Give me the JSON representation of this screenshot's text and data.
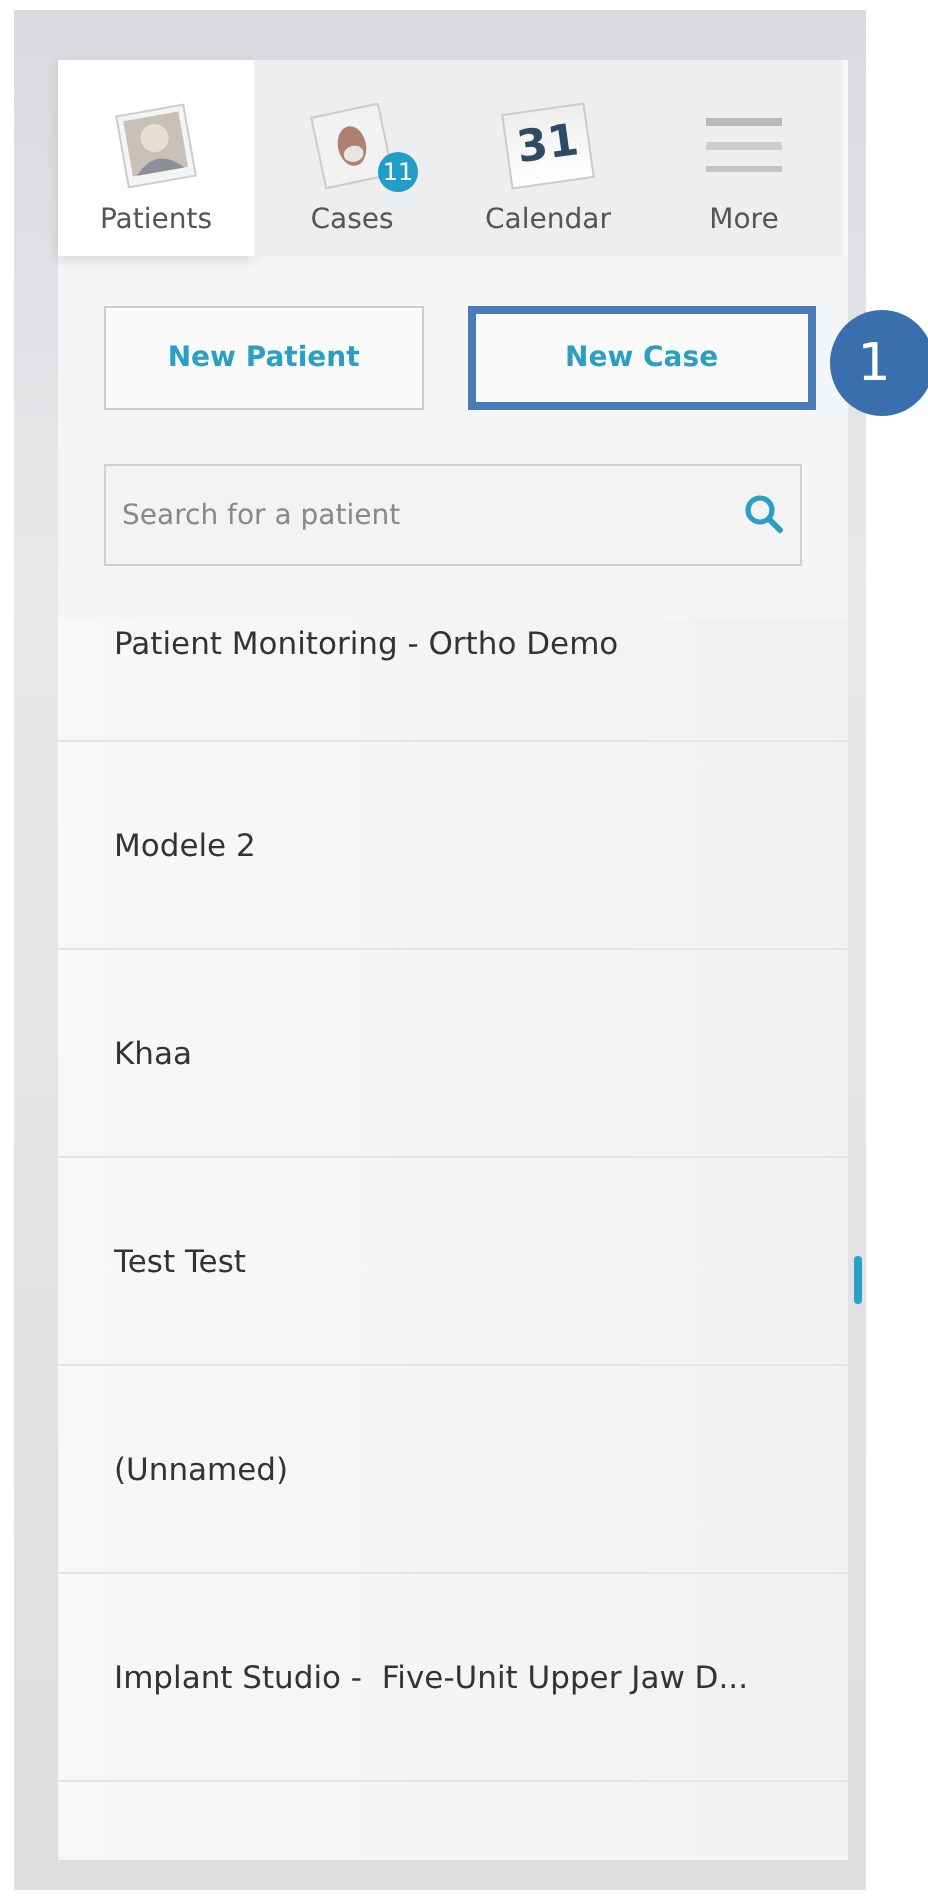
{
  "tabs": [
    {
      "kind": "photo",
      "label": "Patients",
      "selected": true
    },
    {
      "kind": "cases",
      "label": "Cases",
      "selected": false,
      "badge": "11"
    },
    {
      "kind": "calendar",
      "label": "Calendar",
      "selected": false,
      "icon_text": "31"
    },
    {
      "kind": "menu",
      "label": "More",
      "selected": false
    }
  ],
  "buttons": [
    {
      "label": "New Patient",
      "highlighted": false
    },
    {
      "label": "New Case",
      "highlighted": true
    }
  ],
  "callout": "1",
  "search": {
    "placeholder": "Search for a patient"
  },
  "patients": [
    "Patient Monitoring - Ortho Demo",
    "Modele 2",
    "Khaa",
    "Test Test",
    "(Unnamed)",
    "Implant Studio -  Five-Unit Upper Jaw D..."
  ]
}
